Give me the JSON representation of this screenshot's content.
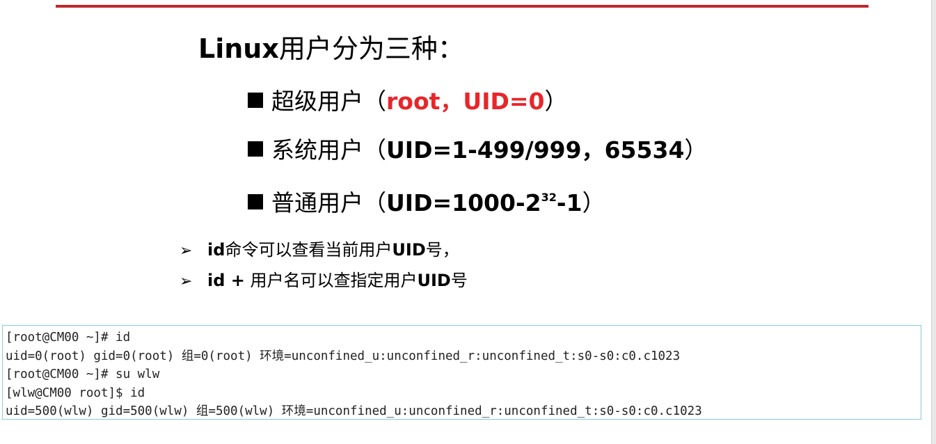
{
  "title": {
    "latin": "Linux",
    "cjk": "用户分为三种："
  },
  "bullets": [
    {
      "prefix": "超级用户（",
      "highlight": "root，UID=0",
      "suffix": "）"
    },
    {
      "prefix": "系统用户（",
      "bold": "UID=1-499/999，65534",
      "suffix": "）"
    },
    {
      "prefix": "普通用户（",
      "bold": "UID=1000-2",
      "sup": "32",
      "bold2": "-1",
      "suffix": "）"
    }
  ],
  "notes": [
    {
      "arrow": "➢",
      "bold": "id",
      "text": "命令可以查看当前用户",
      "bold2": "UID",
      "text2": "号，"
    },
    {
      "arrow": "➢",
      "bold": "id +",
      "text": " 用户名可以查指定用户",
      "bold2": "UID",
      "text2": "号"
    }
  ],
  "terminal": {
    "lines": [
      "[root@CM00 ~]# id",
      "uid=0(root) gid=0(root) 组=0(root) 环境=unconfined_u:unconfined_r:unconfined_t:s0-s0:c0.c1023",
      "[root@CM00 ~]# su wlw",
      "[wlw@CM00 root]$ id",
      "uid=500(wlw) gid=500(wlw) 组=500(wlw) 环境=unconfined_u:unconfined_r:unconfined_t:s0-s0:c0.c1023"
    ]
  },
  "colors": {
    "rule": "#c0272d",
    "highlight": "#e8262a",
    "terminal_border": "#8cc7d6"
  }
}
